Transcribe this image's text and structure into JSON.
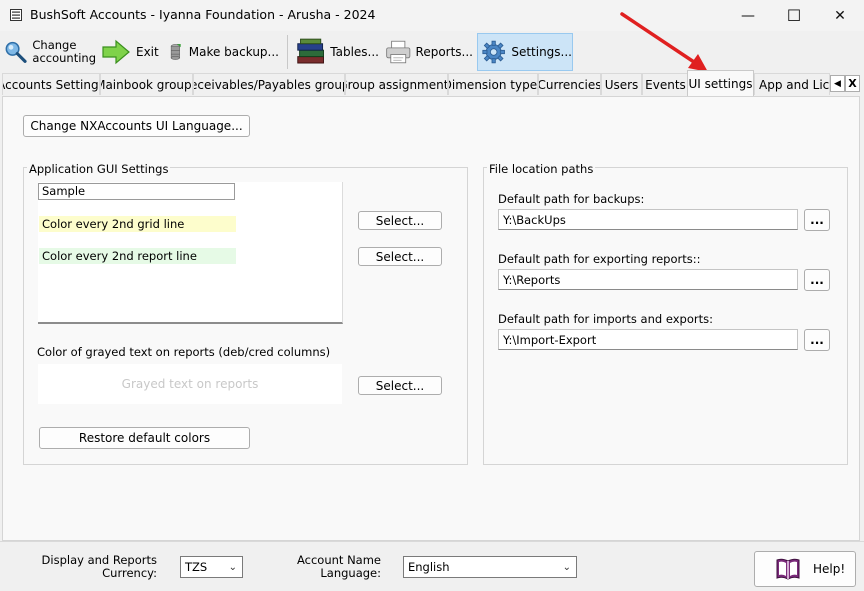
{
  "window": {
    "title": "BushSoft Accounts - Iyanna Foundation  - Arusha - 2024",
    "minimize_glyph": "—",
    "maximize_glyph": "☐",
    "close_glyph": "✕"
  },
  "toolbar": {
    "change_accounting_line1": "Change",
    "change_accounting_line2": "accounting",
    "exit": "Exit",
    "make_backup": "Make backup...",
    "tables": "Tables...",
    "reports": "Reports...",
    "settings": "Settings..."
  },
  "tabs": [
    {
      "label": "Accounts Settings"
    },
    {
      "label": "Mainbook groups"
    },
    {
      "label": "Receivables/Payables groups"
    },
    {
      "label": "Group assignments"
    },
    {
      "label": "Dimension types"
    },
    {
      "label": "Currencies"
    },
    {
      "label": "Users"
    },
    {
      "label": "Events"
    },
    {
      "label": "UI settings"
    },
    {
      "label": "App and Licens"
    }
  ],
  "tab_nav": {
    "left": "◀",
    "close": "X"
  },
  "ui_settings": {
    "change_language_button": "Change NXAccounts UI Language...",
    "gui_group": {
      "title": "Application GUI Settings",
      "sample": "Sample",
      "grid_line_label": "Color every 2nd grid line",
      "report_line_label": "Color every 2nd report line",
      "select_grid": "Select...",
      "select_report": "Select...",
      "grayed_label": "Color of grayed text on reports (deb/cred columns)",
      "grayed_sample": "Grayed text on reports",
      "select_grayed": "Select...",
      "restore_button": "Restore default colors"
    },
    "paths_group": {
      "title": "File location paths",
      "backups_label": "Default path for backups:",
      "backups_value": "Y:\\BackUps",
      "reports_label": "Default path for exporting reports::",
      "reports_value": "Y:\\Reports",
      "imports_label": "Default path for imports and exports:",
      "imports_value": "Y:\\Import-Export",
      "browse": "..."
    }
  },
  "bottom": {
    "currency_label_line1": "Display and Reports",
    "currency_label_line2": "Currency:",
    "currency_value": "TZS",
    "language_label_line1": "Account Name",
    "language_label_line2": "Language:",
    "language_value": "English",
    "help": "Help!"
  },
  "colors": {
    "grid_line": "#fdfdcc",
    "report_line": "#e6fae6",
    "active_toolbar": "#cce4f7",
    "annotation_arrow": "#e02020"
  }
}
